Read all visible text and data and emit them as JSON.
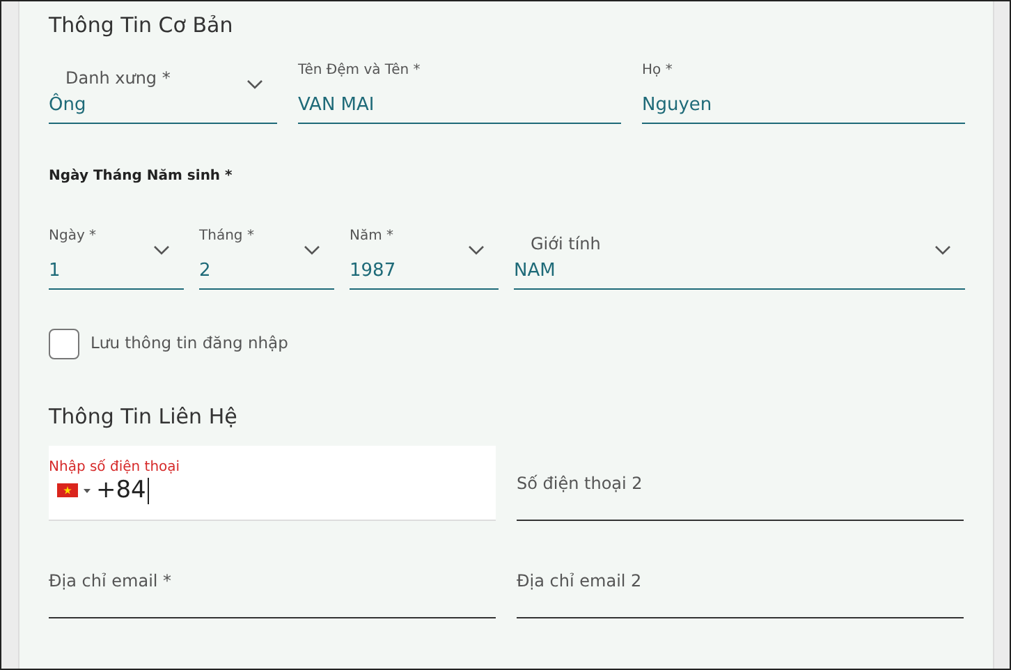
{
  "basic_info": {
    "title": "Thông Tin Cơ Bản",
    "name_fields": [
      {
        "kind": "select",
        "label": "Danh xưng *",
        "label_raised": false,
        "value": "Ông"
      },
      {
        "kind": "text",
        "label": "Tên Đệm và Tên *",
        "label_raised": true,
        "value": "VAN MAI"
      },
      {
        "kind": "text",
        "label": "Họ *",
        "label_raised": true,
        "value": "Nguyen"
      }
    ],
    "birth_label": "Ngày Tháng Năm sinh *",
    "birth_fields": [
      {
        "kind": "select",
        "label": "Ngày *",
        "label_raised": true,
        "value": "1"
      },
      {
        "kind": "select",
        "label": "Tháng *",
        "label_raised": true,
        "value": "2"
      },
      {
        "kind": "select",
        "label": "Năm *",
        "label_raised": true,
        "value": "1987"
      },
      {
        "kind": "select",
        "label": "Giới tính",
        "label_raised": false,
        "value": "NAM"
      }
    ],
    "remember": {
      "label": "Lưu thông tin đăng nhập",
      "checked": false
    }
  },
  "contact_info": {
    "title": "Thông Tin Liên Hệ",
    "fields": [
      {
        "kind": "phone",
        "label": "Nhập số điện thoại",
        "invalid": true,
        "value": "+84"
      },
      {
        "kind": "text",
        "label": "Số điện thoại 2",
        "label_raised": false
      },
      {
        "kind": "text",
        "label": "Địa chỉ email *",
        "label_raised": false
      },
      {
        "kind": "text",
        "label": "Địa chỉ email 2",
        "label_raised": false
      }
    ]
  }
}
